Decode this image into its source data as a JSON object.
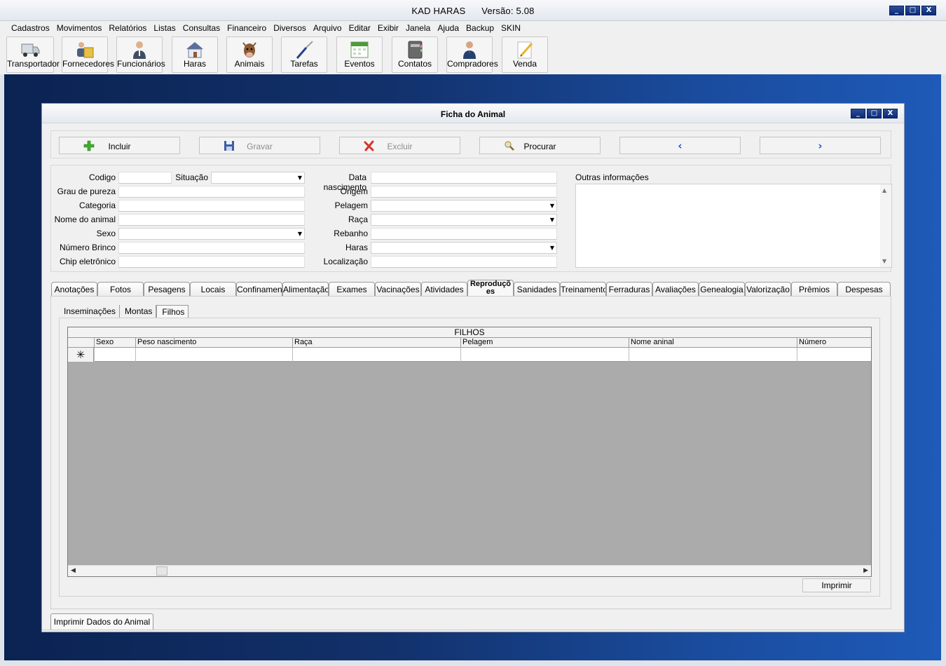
{
  "app": {
    "title": "KAD HARAS      Versão: 5.08",
    "controls": [
      "_",
      "□",
      "X"
    ]
  },
  "menu": [
    "Cadastros",
    "Movimentos",
    "Relatórios",
    "Listas",
    "Consultas",
    "Financeiro",
    "Diversos",
    "Arquivo",
    "Editar",
    "Exibir",
    "Janela",
    "Ajuda",
    "Backup",
    "SKIN"
  ],
  "toolbar": [
    {
      "label": "Transportador",
      "icon": "truck-icon"
    },
    {
      "label": "Fornecedores",
      "icon": "suppliers-icon"
    },
    {
      "label": "Funcionários",
      "icon": "employee-icon"
    },
    {
      "label": "Haras",
      "icon": "house-icon"
    },
    {
      "label": "Animais",
      "icon": "cow-icon"
    },
    {
      "label": "Tarefas",
      "icon": "screwdriver-icon"
    },
    {
      "label": "Eventos",
      "icon": "calendar-icon"
    },
    {
      "label": "Contatos",
      "icon": "address-book-icon"
    },
    {
      "label": "Compradores",
      "icon": "buyer-icon"
    },
    {
      "label": "Venda",
      "icon": "pencil-note-icon"
    }
  ],
  "child": {
    "title": "Ficha do Animal"
  },
  "actions": {
    "incluir": "Incluir",
    "gravar": "Gravar",
    "excluir": "Excluir",
    "procurar": "Procurar",
    "prev": "‹",
    "next": "›"
  },
  "form": {
    "codigo": "Codigo",
    "situacao": "Situação",
    "data_nascimento": "Data nascimento",
    "outras": "Outras informações",
    "grau": "Grau de pureza",
    "origem": "Origem",
    "categoria": "Categoria",
    "pelagem": "Pelagem",
    "nome": "Nome do animal",
    "raca": "Raça",
    "sexo": "Sexo",
    "rebanho": "Rebanho",
    "brinco": "Número Brinco",
    "haras": "Haras",
    "chip": "Chip eletrônico",
    "localizacao": "Localização"
  },
  "tabs": [
    "Anotações",
    "Fotos",
    "Pesagens",
    "Locais",
    "Confinamen",
    "Alimentação",
    "Exames",
    "Vacinações",
    "Atividades",
    "Reproduções",
    "Sanidades",
    "Treinamentos",
    "Ferraduras",
    "Avaliações",
    "Genealogia",
    "Valorização",
    "Prêmios",
    "Despesas"
  ],
  "subtabs": [
    "Inseminações",
    "Montas",
    "Filhos"
  ],
  "grid": {
    "title": "FILHOS",
    "columns": [
      "Sexo",
      "Peso nascimento",
      "Raça",
      "Pelagem",
      "Nome aninal",
      "Número"
    ],
    "new_row_marker": "✳"
  },
  "imprimir": "Imprimir",
  "print_animal": "Imprimir Dados do Animal"
}
